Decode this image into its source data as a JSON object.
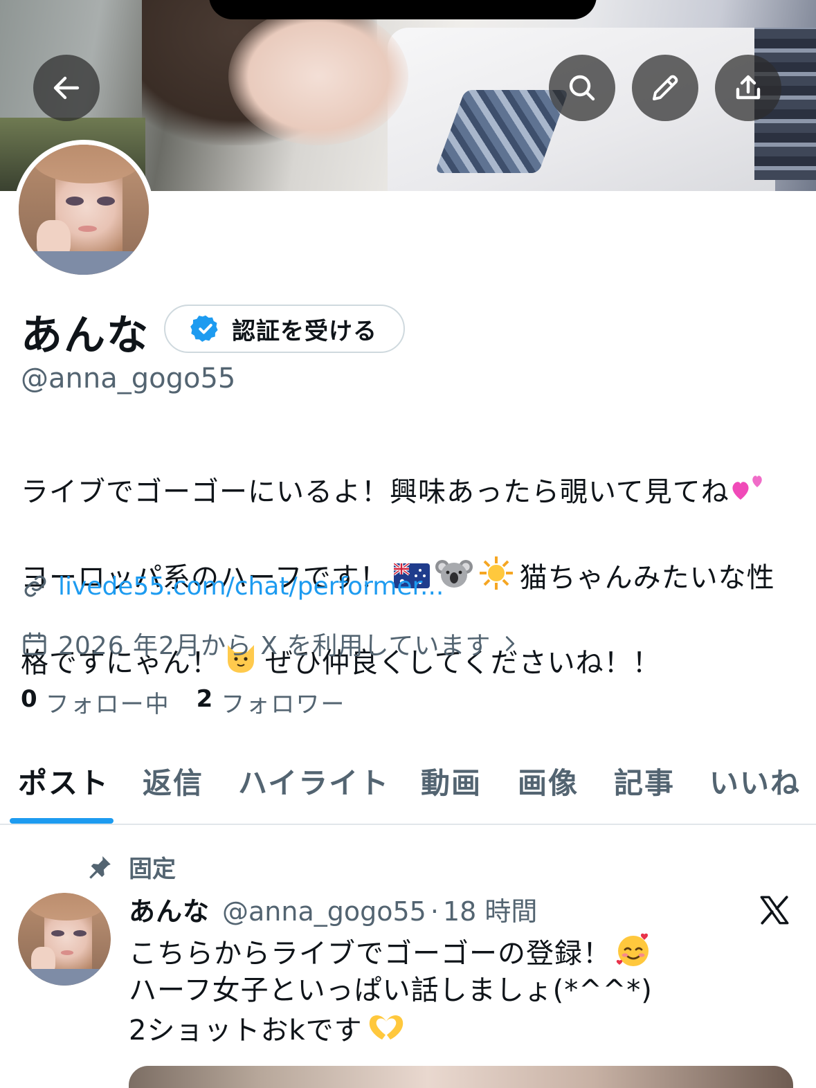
{
  "header": {
    "back_icon": "arrow-left-icon",
    "search_icon": "search-icon",
    "edit_icon": "pencil-icon",
    "share_icon": "share-icon"
  },
  "profile": {
    "display_name": "あんな",
    "verify_button_label": "認証を受ける",
    "handle": "@anna_gogo55",
    "bio_lines": [
      "ライブでゴーゴーにいるよ！興味あったら覗いて見てね",
      "ヨーロッパ系のハーフです！",
      "猫ちゃんみたいな性",
      "格ですにゃん！",
      "ぜひ仲良くしてくださいね！！"
    ],
    "link": "livede55.com/chat/performer...",
    "joined": "2026 年2月から X を利用しています",
    "following_count": "0",
    "following_label": "フォロー中",
    "followers_count": "2",
    "followers_label": "フォロワー"
  },
  "tabs": [
    {
      "label": "ポスト",
      "active": true
    },
    {
      "label": "返信",
      "active": false
    },
    {
      "label": "ハイライト",
      "active": false
    },
    {
      "label": "動画",
      "active": false
    },
    {
      "label": "画像",
      "active": false
    },
    {
      "label": "記事",
      "active": false
    },
    {
      "label": "いいね",
      "active": false
    }
  ],
  "pinned_post": {
    "pinned_label": "固定",
    "author_name": "あんな",
    "author_handle": "@anna_gogo55",
    "separator": "·",
    "time": "18 時間",
    "body_lines": [
      "こちらからライブでゴーゴーの登録！",
      "ハーフ女子といっぱい話しましょ(*^^*)",
      "2ショットおkです"
    ]
  },
  "colors": {
    "accent": "#1d9bf0",
    "text_primary": "#0f1419",
    "text_secondary": "#536471",
    "border": "#cfd9de"
  }
}
